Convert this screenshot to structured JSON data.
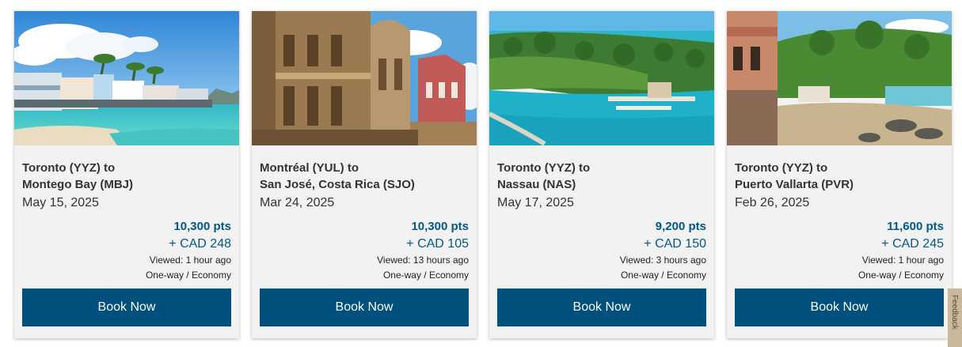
{
  "cards": [
    {
      "origin": "Toronto (YYZ) to",
      "destination": "Montego Bay (MBJ)",
      "date": "May 15, 2025",
      "points": "10,300 pts",
      "cash": "+ CAD 248",
      "viewed": "Viewed: 1 hour ago",
      "fare": "One-way / Economy",
      "button": "Book Now"
    },
    {
      "origin": "Montréal (YUL) to",
      "destination": "San José, Costa Rica (SJO)",
      "date": "Mar 24, 2025",
      "points": "10,300 pts",
      "cash": "+ CAD 105",
      "viewed": "Viewed: 13 hours ago",
      "fare": "One-way / Economy",
      "button": "Book Now"
    },
    {
      "origin": "Toronto (YYZ) to",
      "destination": "Nassau (NAS)",
      "date": "May 17, 2025",
      "points": "9,200 pts",
      "cash": "+ CAD 150",
      "viewed": "Viewed: 3 hours ago",
      "fare": "One-way / Economy",
      "button": "Book Now"
    },
    {
      "origin": "Toronto (YYZ) to",
      "destination": "Puerto Vallarta (PVR)",
      "date": "Feb 26, 2025",
      "points": "11,600 pts",
      "cash": "+ CAD 245",
      "viewed": "Viewed: 1 hour ago",
      "fare": "One-way / Economy",
      "button": "Book Now"
    }
  ],
  "feedback_tab": {
    "label": "Feedback"
  },
  "colors": {
    "button": "#00507d",
    "price": "#005a87",
    "card_background": "#f2f2f2"
  }
}
